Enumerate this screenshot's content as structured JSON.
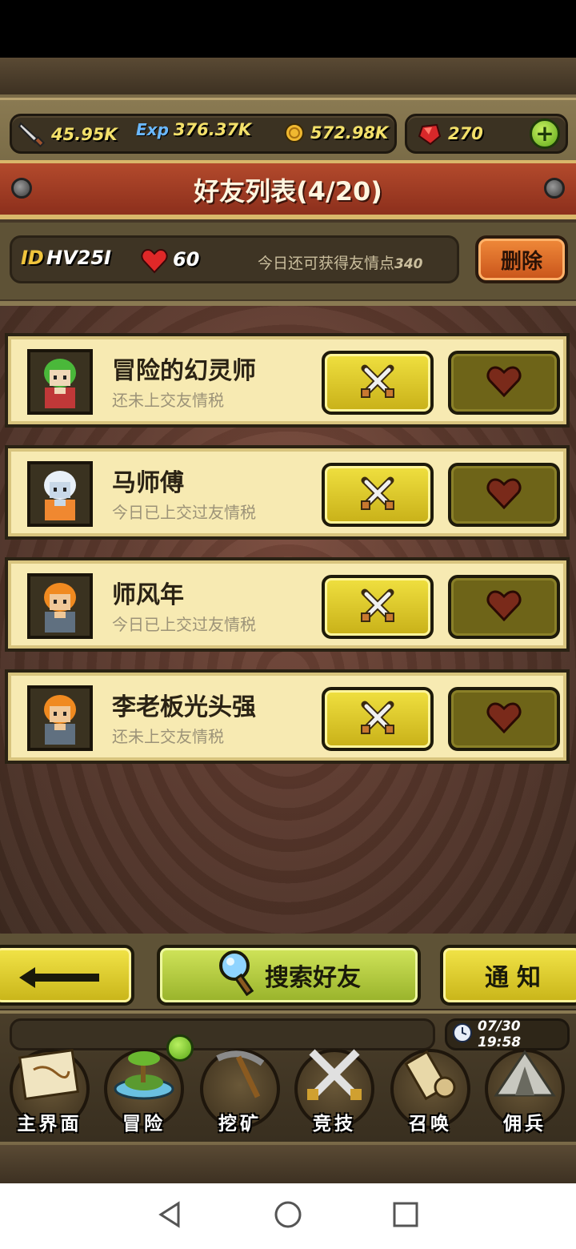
{
  "resources": {
    "attack": {
      "icon": "sword-icon",
      "value": "45.95K"
    },
    "exp": {
      "icon": "exp-icon",
      "value": "376.37K"
    },
    "gold": {
      "icon": "gold-coin-icon",
      "value": "572.98K"
    },
    "gem": {
      "icon": "ruby-gem-icon",
      "value": "270"
    }
  },
  "title": "好友列表(4/20)",
  "info": {
    "id_label": "ID",
    "id_value": "HV25I",
    "hearts": "60",
    "friend_points_text": "今日还可获得友情点",
    "friend_points_value": "340",
    "delete_label": "删除"
  },
  "friends": [
    {
      "name": "冒险的幻灵师",
      "status": "还未上交友情税",
      "avatar": "green-hair-mage-avatar"
    },
    {
      "name": "马师傅",
      "status": "今日已上交过友情税",
      "avatar": "white-bear-avatar"
    },
    {
      "name": "师风年",
      "status": "今日已上交过友情税",
      "avatar": "orange-hair-knight-avatar"
    },
    {
      "name": "李老板光头强",
      "status": "还未上交友情税",
      "avatar": "orange-hair-knight-avatar"
    }
  ],
  "buttons": {
    "search_label": "搜索好友",
    "notice_label": "通知"
  },
  "clock": "07/30 19:58",
  "nav": [
    {
      "label": "主界面",
      "icon": "scroll-map-icon"
    },
    {
      "label": "冒险",
      "icon": "island-icon"
    },
    {
      "label": "挖矿",
      "icon": "pickaxe-icon"
    },
    {
      "label": "竞技",
      "icon": "crossed-swords-icon"
    },
    {
      "label": "召唤",
      "icon": "summon-scroll-icon"
    },
    {
      "label": "佣兵",
      "icon": "tent-icon"
    }
  ],
  "colors": {
    "accent_yellow": "#f0e040",
    "banner_red": "#b34a2c",
    "card_bg": "#f7eab2",
    "delete_orange": "#f08a3a"
  }
}
